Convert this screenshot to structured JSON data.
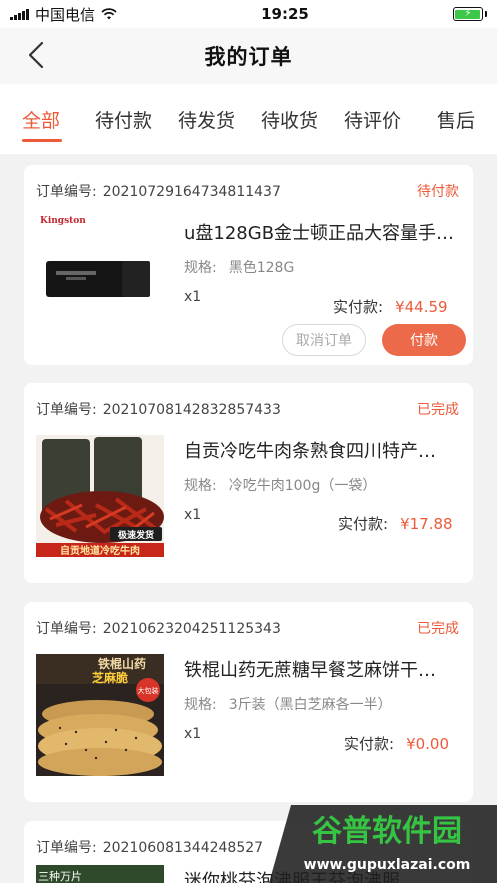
{
  "status_bar": {
    "carrier": "中国电信",
    "time": "19:25"
  },
  "nav": {
    "title": "我的订单"
  },
  "tabs": [
    {
      "label": "全部",
      "active": true
    },
    {
      "label": "待付款",
      "active": false
    },
    {
      "label": "待发货",
      "active": false
    },
    {
      "label": "待收货",
      "active": false
    },
    {
      "label": "待评价",
      "active": false
    },
    {
      "label": "售后",
      "active": false
    }
  ],
  "orders": [
    {
      "order_no_label": "订单编号:",
      "order_no": "20210729164734811437",
      "status": "待付款",
      "product_title": "u盘128GB金士顿正品大容量手…",
      "spec_label": "规格:",
      "spec_value": "黑色128G",
      "qty": "x1",
      "paid_label": "实付款:",
      "price": "¥44.59",
      "thumb_brand": "Kingston",
      "buttons": {
        "cancel": "取消订单",
        "pay": "付款"
      }
    },
    {
      "order_no_label": "订单编号:",
      "order_no": "20210708142832857433",
      "status": "已完成",
      "product_title": "自贡冷吃牛肉条熟食四川特产…",
      "spec_label": "规格:",
      "spec_value": "冷吃牛肉100g（一袋）",
      "qty": "x1",
      "paid_label": "实付款:",
      "price": "¥17.88",
      "thumb_tag": "极速发货",
      "thumb_banner": "自贡地道冷吃牛肉"
    },
    {
      "order_no_label": "订单编号:",
      "order_no": "20210623204251125343",
      "status": "已完成",
      "product_title": "铁棍山药无蔗糖早餐芝麻饼干…",
      "spec_label": "规格:",
      "spec_value": "3斤装（黑白芝麻各一半）",
      "qty": "x1",
      "paid_label": "实付款:",
      "price": "¥0.00",
      "thumb_text1": "铁棍山药",
      "thumb_text2": "芝麻脆",
      "thumb_badge": "大包装"
    },
    {
      "order_no_label": "订单编号:",
      "order_no": "202106081344248527",
      "product_title": "迷你桃芬泡沸服王芬泡沸服",
      "thumb_text1": "三种万片"
    }
  ],
  "watermark": {
    "text": "谷普软件园",
    "url": "www.gupuxlazai.com"
  },
  "colors": {
    "accent": "#ec5a3a",
    "pay_button": "#ec6a4a",
    "battery": "#3ec84a"
  }
}
